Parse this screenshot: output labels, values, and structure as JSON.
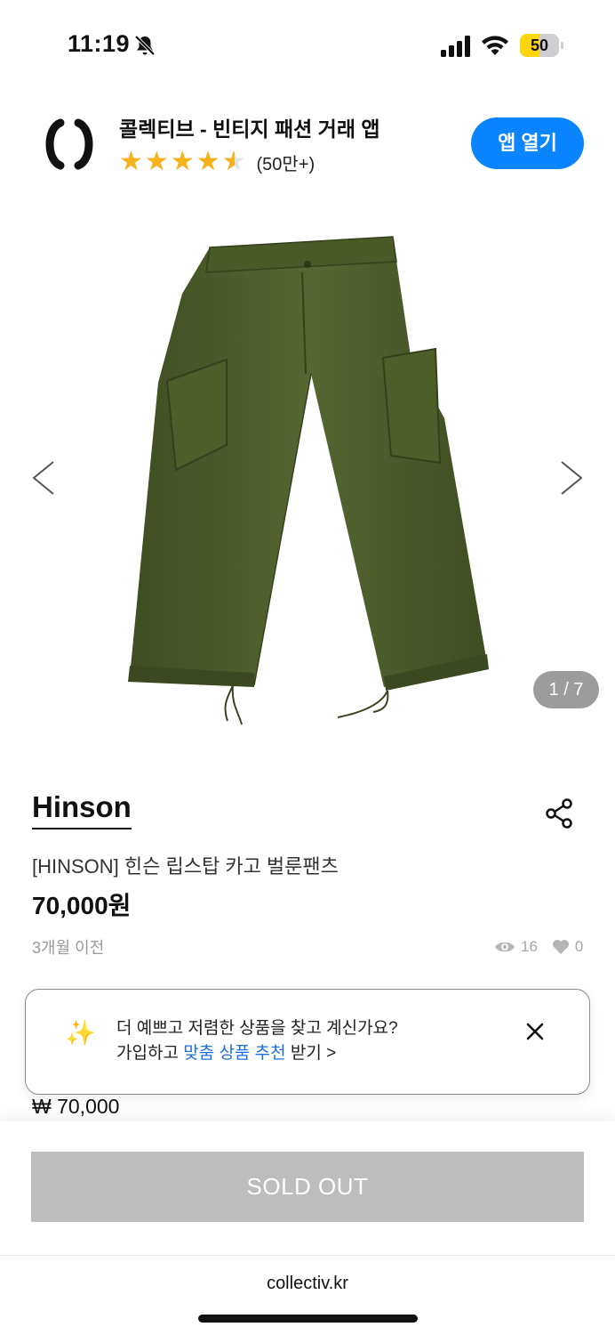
{
  "status_bar": {
    "time": "11:19",
    "battery": "50",
    "battery_level": 0.5
  },
  "app_banner": {
    "title": "콜렉티브 - 빈티지 패션 거래 앱",
    "rating_count": "(50만+)",
    "rating": 4.5,
    "open_button": "앱 열기"
  },
  "gallery": {
    "counter": "1 / 7",
    "product_color": "#4b5a2a"
  },
  "product": {
    "brand": "Hinson",
    "name": "[HINSON] 힌슨 립스탑 카고 벌룬팬츠",
    "price": "70,000원",
    "posted": "3개월 이전",
    "views": "16",
    "likes": "0"
  },
  "toast": {
    "line1": "더 예쁘고 저렴한 상품을 찾고 계신가요?",
    "line2_prefix": "가입하고 ",
    "line2_highlight": "맞춤 상품 추천",
    "line2_suffix": " 받기 >"
  },
  "bottom": {
    "price": "₩ 70,000",
    "button": "SOLD OUT"
  },
  "browser": {
    "url": "collectiv.kr"
  },
  "colors": {
    "accent": "#0a84ff",
    "star": "#f6b21a",
    "link": "#1e6fd9"
  },
  "icons": [
    "bell-off-icon",
    "signal-icon",
    "wifi-icon",
    "battery-icon",
    "app-logo-icon",
    "star-icon",
    "chevron-left-icon",
    "chevron-right-icon",
    "share-icon",
    "eye-icon",
    "heart-icon",
    "sparkle-icon",
    "close-icon"
  ]
}
